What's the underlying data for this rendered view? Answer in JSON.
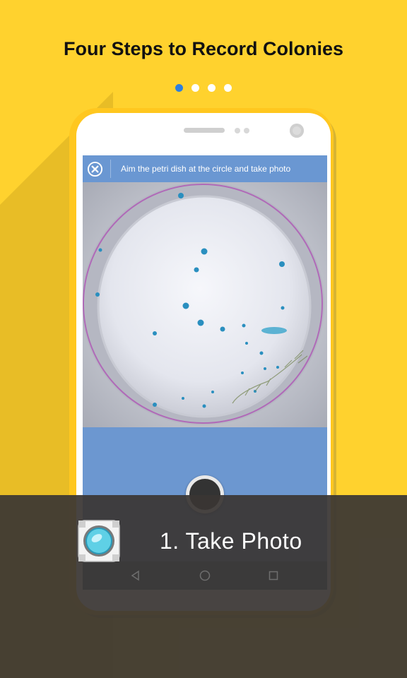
{
  "page": {
    "title": "Four Steps to Record Colonies",
    "pager": {
      "count": 4,
      "active_index": 0
    }
  },
  "colors": {
    "background": "#FFD22E",
    "accent_blue": "#2D7FE0",
    "screen_blue": "#6A97D2",
    "overlay": "#3A3634"
  },
  "camera_screen": {
    "close_icon": "close-circle-icon",
    "instruction": "Aim the petri dish at the circle and take photo"
  },
  "step": {
    "icon": "camera-lens-icon",
    "label": "1. Take Photo"
  },
  "nav": {
    "icons": [
      "back-triangle-icon",
      "home-circle-icon",
      "recents-square-icon"
    ]
  }
}
